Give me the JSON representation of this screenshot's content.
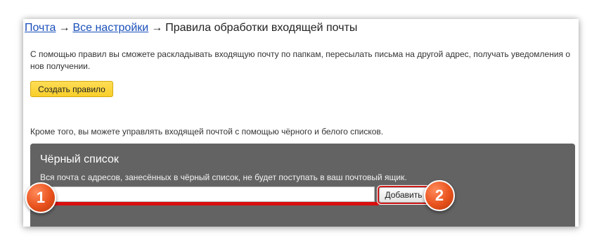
{
  "breadcrumb": {
    "mail": "Почта",
    "arrow1": "→",
    "all_settings": "Все настройки",
    "arrow2": "→",
    "current": "Правила обработки входящей почты"
  },
  "intro_text": "С помощью правил вы сможете раскладывать входящую почту по папкам, пересылать письма на другой адрес, получать уведомления о нов получении.",
  "create_rule_label": "Создать правило",
  "lists_text": "Кроме того, вы можете управлять входящей почтой с помощью чёрного и белого списков.",
  "blacklist": {
    "title": "Чёрный список",
    "description": "Вся почта с адресов, занесённых в чёрный список, не будет поступать в ваш почтовый ящик.",
    "input_value": "",
    "add_label": "Добавить"
  },
  "annotations": {
    "step1": "1",
    "step2": "2",
    "accent_color": "#e8521d",
    "highlight_color": "#d90f0f"
  },
  "colors": {
    "link": "#1a4fba",
    "primary_button": "#f8cf2a",
    "panel_background": "#636363"
  }
}
